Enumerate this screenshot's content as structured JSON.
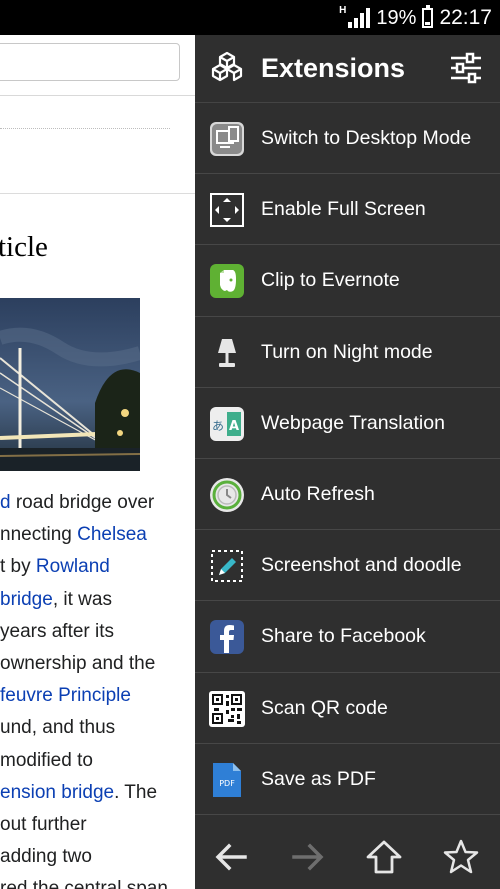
{
  "status": {
    "network": "H",
    "battery": "19%",
    "time": "22:17"
  },
  "page": {
    "title_fragment": "ticle",
    "lines": [
      {
        "link": "d",
        "after": " road bridge over"
      },
      {
        "before": "nnecting ",
        "link": "Chelsea"
      },
      {
        "before": "t by ",
        "link": "Rowland"
      },
      {
        "link": "bridge",
        "after": ", it was"
      },
      {
        "before": " years after its"
      },
      {
        "before": " ownership and the"
      },
      {
        "link": "feuvre Principle"
      },
      {
        "before": "und, and thus"
      },
      {
        "before": "modified to"
      },
      {
        "link": "ension bridge",
        "after": ". The"
      },
      {
        "before": "out further"
      },
      {
        "before": "adding two"
      },
      {
        "before": "red the central span"
      }
    ]
  },
  "drawer": {
    "title": "Extensions",
    "items": [
      {
        "label": "Switch to Desktop Mode",
        "icon": "desktop-mode-icon"
      },
      {
        "label": "Enable Full Screen",
        "icon": "fullscreen-icon"
      },
      {
        "label": "Clip to Evernote",
        "icon": "evernote-icon"
      },
      {
        "label": "Turn on Night mode",
        "icon": "lamp-icon"
      },
      {
        "label": "Webpage Translation",
        "icon": "translate-icon"
      },
      {
        "label": "Auto Refresh",
        "icon": "refresh-timer-icon"
      },
      {
        "label": "Screenshot and doodle",
        "icon": "screenshot-doodle-icon"
      },
      {
        "label": "Share to Facebook",
        "icon": "facebook-icon"
      },
      {
        "label": "Scan QR code",
        "icon": "qr-code-icon"
      },
      {
        "label": "Save as PDF",
        "icon": "pdf-icon"
      }
    ],
    "pdf_icon_text": "PDF",
    "translate_icon_text": "あA"
  },
  "colors": {
    "drawer_bg": "#2f2f2f",
    "link": "#0b3fb3",
    "evernote": "#5fb133",
    "facebook": "#3b5998",
    "pdf": "#2f7fd6"
  }
}
